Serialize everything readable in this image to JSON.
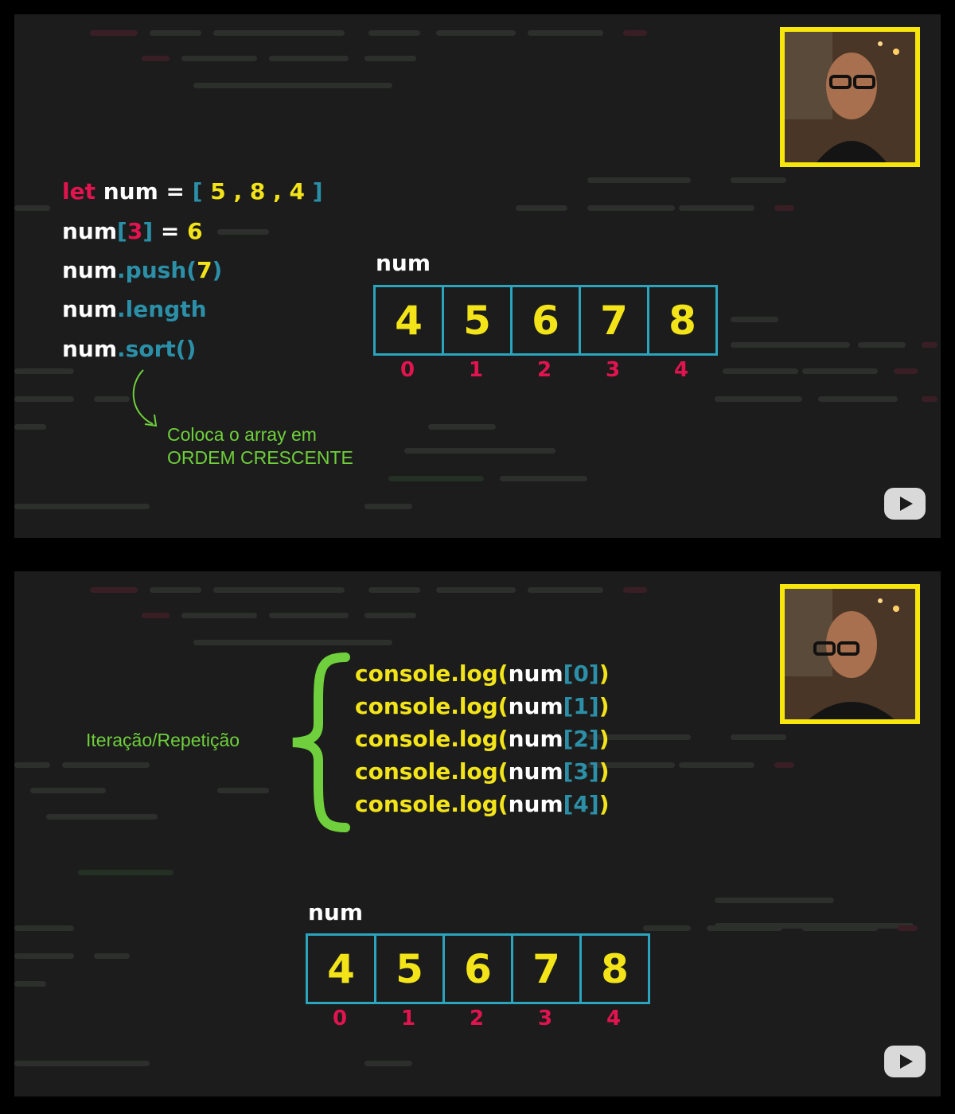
{
  "panel1": {
    "code_lines": {
      "l1": {
        "kw": "let",
        "a": " num = ",
        "b": "[",
        "c": " 5 , 8 , 4 ",
        "d": "]"
      },
      "l2": {
        "a": "num",
        "b": "[",
        "c": "3",
        "d": "]",
        "e": " = ",
        "f": "6"
      },
      "l3": {
        "a": "num",
        "b": ".push(",
        "c": "7",
        "d": ")"
      },
      "l4": {
        "a": "num",
        "b": ".length"
      },
      "l5": {
        "a": "num",
        "b": ".sort()"
      }
    },
    "note": {
      "line1": "Coloca o array em",
      "line2": "ORDEM CRESCENTE"
    },
    "array_label": "num",
    "array_values": [
      "4",
      "5",
      "6",
      "7",
      "8"
    ],
    "array_indices": [
      "0",
      "1",
      "2",
      "3",
      "4"
    ]
  },
  "panel2": {
    "label": "Iteração/Repetição",
    "log_lines": [
      {
        "a": "console.log(",
        "b": "num",
        "c": "[",
        "d": "0",
        "e": "]",
        "f": ")"
      },
      {
        "a": "console.log(",
        "b": "num",
        "c": "[",
        "d": "1",
        "e": "]",
        "f": ")"
      },
      {
        "a": "console.log(",
        "b": "num",
        "c": "[",
        "d": "2",
        "e": "]",
        "f": ")"
      },
      {
        "a": "console.log(",
        "b": "num",
        "c": "[",
        "d": "3",
        "e": "]",
        "f": ")"
      },
      {
        "a": "console.log(",
        "b": "num",
        "c": "[",
        "d": "4",
        "e": "]",
        "f": ")"
      }
    ],
    "array_label": "num",
    "array_values": [
      "4",
      "5",
      "6",
      "7",
      "8"
    ],
    "array_indices": [
      "0",
      "1",
      "2",
      "3",
      "4"
    ]
  },
  "colors": {
    "keyword": "#e2144f",
    "number": "#f3e41a",
    "accent": "#2aa5bd",
    "note": "#6fcf3c",
    "frame": "#f7e60c"
  },
  "icons": {
    "webcam": "presenter-webcam",
    "play": "play-icon",
    "brace": "curly-brace-icon",
    "arrow": "curved-arrow-icon"
  }
}
